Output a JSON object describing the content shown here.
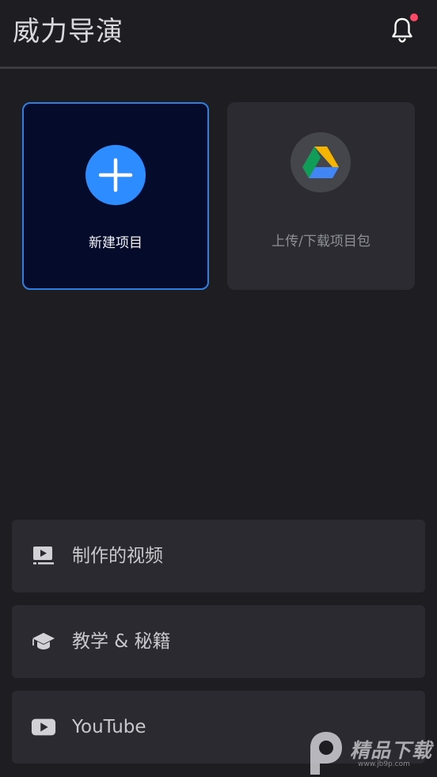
{
  "header": {
    "title": "威力导演",
    "bell_icon": "bell-icon",
    "notification_dot_color": "#ff4766"
  },
  "cards": {
    "new_project": {
      "label": "新建项目",
      "icon": "plus-icon",
      "accent": "#2d8cff"
    },
    "upload": {
      "label": "上传/下载项目包",
      "icon": "google-drive-icon"
    }
  },
  "list": {
    "items": [
      {
        "label": "制作的视频",
        "icon": "video-library-icon"
      },
      {
        "label": "教学 & 秘籍",
        "icon": "graduation-cap-icon"
      },
      {
        "label": "YouTube",
        "icon": "youtube-icon"
      }
    ]
  },
  "watermark": {
    "text": "精品下载",
    "url": "www.jb9p.com"
  }
}
